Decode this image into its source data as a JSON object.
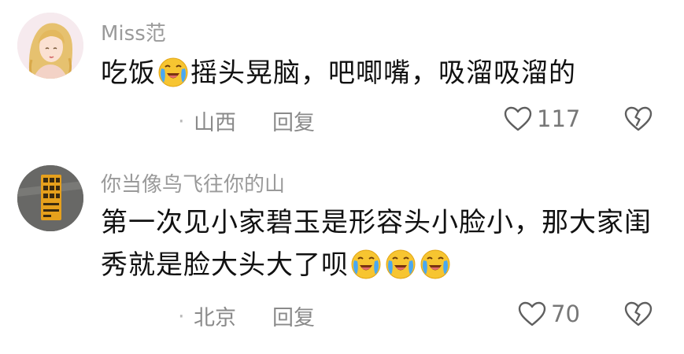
{
  "comments": [
    {
      "username": "Miss范",
      "text_parts": [
        "吃饭",
        "摇头晃脑，吧唧嘴，吸溜吸溜的"
      ],
      "emojis": [
        "loudly-crying-face-icon"
      ],
      "location": "山西",
      "reply_label": "回复",
      "like_count": "117"
    },
    {
      "username": "你当像鸟飞往你的山",
      "text_lines": [
        "第一次见小家碧玉是形容头小脸小，那大家闺",
        "秀就是脸大头大了呗"
      ],
      "emojis": [
        "loudly-crying-face-icon",
        "loudly-crying-face-icon",
        "loudly-crying-face-icon"
      ],
      "location": "北京",
      "reply_label": "回复",
      "like_count": "70"
    }
  ],
  "colors": {
    "username": "#9a9a9a",
    "text": "#111111",
    "meta": "#8a8a8a",
    "emoji_face": "#f7c531"
  }
}
